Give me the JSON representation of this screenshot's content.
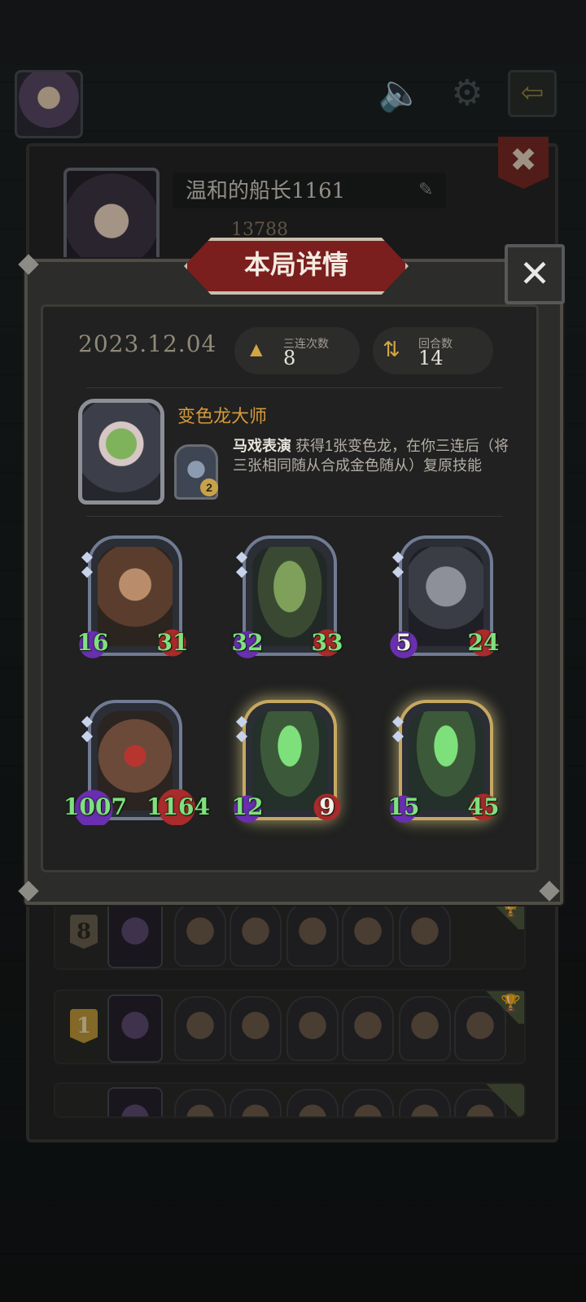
{
  "top_bar": {
    "speaker_icon": "speaker-icon",
    "settings_icon": "gear-icon",
    "exit_icon": "exit-arrow-icon"
  },
  "profile": {
    "name": "温和的船长1161",
    "score": "13788"
  },
  "modal": {
    "title": "本局详情",
    "date": "2023.12.04",
    "triples_label": "三连次数",
    "triples_value": "8",
    "turns_label": "回合数",
    "turns_value": "14",
    "hero_name": "变色龙大师",
    "hero_power_badge": "2",
    "skill_name": "马戏表演",
    "skill_desc": " 获得1张变色龙，在你三连后（将三张相同随从合成金色随从）复原技能",
    "minions": [
      {
        "attack": "16",
        "health": "31",
        "golden": false,
        "art": "brute-portrait"
      },
      {
        "attack": "32",
        "health": "33",
        "golden": false,
        "art": "plant-monster-portrait"
      },
      {
        "attack": "5",
        "health": "24",
        "golden": false,
        "art": "armored-knight-portrait"
      },
      {
        "attack": "1007",
        "health": "1164",
        "golden": false,
        "art": "hound-pack-portrait"
      },
      {
        "attack": "12",
        "health": "9",
        "golden": true,
        "art": "cursed-sword-portrait"
      },
      {
        "attack": "15",
        "health": "45",
        "golden": true,
        "art": "cursed-sword-portrait"
      }
    ]
  },
  "history_rows": [
    {
      "rank": "8"
    },
    {
      "rank": "1"
    },
    {
      "rank": ""
    }
  ],
  "colors": {
    "accent_orange": "#d79a3a",
    "title_red": "#7a1f1e",
    "stat_green": "#7fe07e",
    "golden_border": "#c7a860"
  }
}
